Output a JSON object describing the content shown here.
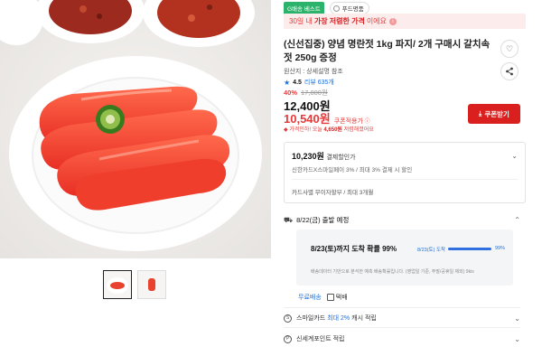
{
  "badges": {
    "green": "G배송 베스트",
    "food": "푸드명품"
  },
  "promo": {
    "prefix": "30일 내",
    "highlight": "가장 저렴한 가격",
    "suffix": "이에요"
  },
  "product": {
    "title": "(신선집중) 양념 명란젓 1kg 파지/ 2개 구매시 갈치속젓 250g 증정",
    "origin": "원산지 : 상세설명 참조",
    "rating": "4.5",
    "reviews": "리뷰 635개",
    "discount_pct": "40%",
    "original_price": "17,800원",
    "price": "12,400원",
    "coupon_price": "10,540원",
    "coupon_label": "쿠폰적용가",
    "lowest_note_pre": "가격인하! 오늘",
    "lowest_note_amt": "4,650원",
    "lowest_note_post": "저렴해졌어요"
  },
  "buttons": {
    "coupon": "쿠폰받기"
  },
  "card_discount": {
    "amount": "10,230원",
    "amount_label": "결제할인가",
    "line1": "신한카드X스마일페이 3% / 최대 3% 결제 시 할인",
    "line2": "카드사별 무이자할부 / 최대 3개월"
  },
  "shipping": {
    "date": "8/22(금) 출발 예정",
    "arrival": "8/23(토)까지 도착 확률 99%",
    "bar_label": "8/23(토) 도착",
    "bar_pct": "99%",
    "bar_value": 0.99,
    "note": "배송데이터 기반으로 분석한 예측 배송확률입니다. (영업일 기준, 주말/공휴일 제외) 9kis",
    "free": "무료배송",
    "method": "택배"
  },
  "rows": {
    "smile_prefix": "스마일카드",
    "smile_highlight": "최대 2%",
    "smile_suffix": "캐시 적립",
    "point": "신세계포인트 적립"
  },
  "icons": [
    "heart-icon",
    "share-icon",
    "download-icon",
    "truck-icon",
    "chevron-down-icon",
    "star-icon"
  ],
  "colors": {
    "accent_red": "#d9201f",
    "price_red": "#e53a3a",
    "blue": "#1e6fd9",
    "green": "#2cb36b"
  }
}
